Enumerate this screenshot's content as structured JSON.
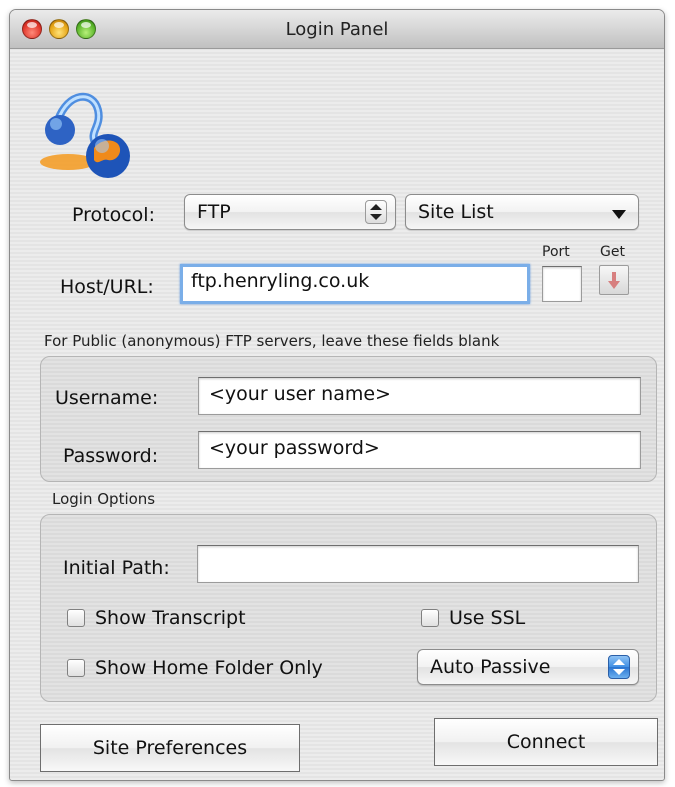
{
  "window": {
    "title": "Login Panel"
  },
  "app_icon": {
    "icon": "globe-network-icon"
  },
  "protocol": {
    "label": "Protocol:",
    "value": "FTP"
  },
  "site_list": {
    "value": "Site List"
  },
  "port": {
    "label": "Port",
    "value": ""
  },
  "get": {
    "label": "Get",
    "icon": "download-arrow-icon"
  },
  "host": {
    "label": "Host/URL:",
    "value": "ftp.henryling.co.uk"
  },
  "anon_hint": "For Public (anonymous) FTP servers, leave these fields blank",
  "credentials": {
    "username_label": "Username:",
    "username_value": "<your user name>",
    "password_label": "Password:",
    "password_value": "<your password>"
  },
  "login_options": {
    "label": "Login Options",
    "initial_path_label": "Initial Path:",
    "initial_path_value": "",
    "show_transcript": {
      "label": "Show Transcript",
      "checked": false
    },
    "use_ssl": {
      "label": "Use SSL",
      "checked": false
    },
    "show_home_folder_only": {
      "label": "Show Home Folder Only",
      "checked": false
    },
    "passive_mode": {
      "value": "Auto Passive"
    }
  },
  "buttons": {
    "site_preferences": "Site Preferences",
    "connect": "Connect"
  },
  "colors": {
    "focus_ring": "#7aaee8",
    "stepper_blue": "#3f8fe4"
  }
}
